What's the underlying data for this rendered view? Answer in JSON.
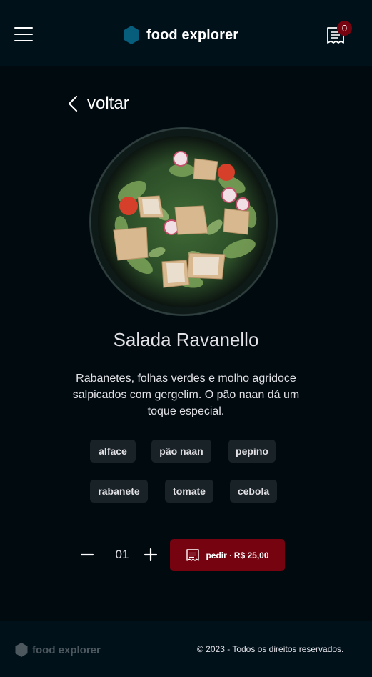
{
  "header": {
    "brand_name": "food explorer",
    "cart_count": "0",
    "brand_color": "#065e7c",
    "menu_icon": "hamburger-menu-icon",
    "receipt_icon": "receipt-icon"
  },
  "nav": {
    "back_label": "voltar",
    "back_icon": "chevron-left-icon"
  },
  "dish": {
    "name": "Salada Ravanello",
    "description": "Rabanetes, folhas verdes e molho agridoce salpicados com gergelim. O pão naan dá um toque especial.",
    "ingredients": [
      "alface",
      "pão naan",
      "pepino",
      "rabanete",
      "tomate",
      "cebola"
    ]
  },
  "order": {
    "quantity": "01",
    "button_label": "pedir ∙ R$ 25,00",
    "accent_color": "#750310"
  },
  "footer": {
    "brand_name": "food explorer",
    "copyright": "© 2023 - Todos os direitos reservados."
  }
}
